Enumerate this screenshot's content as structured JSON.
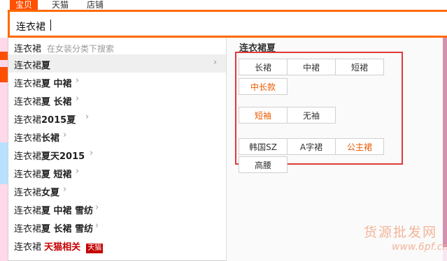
{
  "tabs": [
    "宝贝",
    "天猫",
    "店铺"
  ],
  "search": {
    "value": "连衣裙"
  },
  "suggestions": [
    {
      "prefix": "连衣裙",
      "bold": "",
      "hint": "在女装分类下搜索",
      "arrow": false
    },
    {
      "prefix": "连衣裙",
      "bold": "夏",
      "hint": "",
      "arrow": true
    },
    {
      "prefix": "连衣裙",
      "bold": "夏 中裙",
      "hint": "",
      "arrow": true
    },
    {
      "prefix": "连衣裙",
      "bold": "夏 长裙",
      "hint": "",
      "arrow": true
    },
    {
      "prefix": "连衣裙",
      "bold": "2015夏",
      "hint": "",
      "arrow": true
    },
    {
      "prefix": "连衣裙",
      "bold": "长裙",
      "hint": "",
      "arrow": true
    },
    {
      "prefix": "连衣裙",
      "bold": "夏天2015",
      "hint": "",
      "arrow": true
    },
    {
      "prefix": "连衣裙",
      "bold": "夏 短裙",
      "hint": "",
      "arrow": true
    },
    {
      "prefix": "连衣裙",
      "bold": "女夏",
      "hint": "",
      "arrow": true
    },
    {
      "prefix": "连衣裙",
      "bold": "夏 中裙 雪纺",
      "hint": "",
      "arrow": true
    },
    {
      "prefix": "连衣裙",
      "bold": "夏 长裙 雪纺",
      "hint": "",
      "arrow": true
    }
  ],
  "tmall_row": {
    "prefix": "连衣裙",
    "label": "天猫相关",
    "badge": "天猫"
  },
  "panel": {
    "title": "连衣裙夏",
    "group1": [
      "长裙",
      "中裙",
      "短裙",
      "中长款"
    ],
    "group2": [
      "短袖",
      "无袖"
    ],
    "group3": [
      "韩国SZ",
      "A字裙",
      "公主裙",
      "高腰"
    ]
  },
  "watermark": {
    "line1": "货源批发网",
    "line2": "www.6pf.cn"
  },
  "colors": {
    "accent": "#ff6a00",
    "highlight_box": "#e03a3a",
    "hot_text": "#e85a00",
    "tmall": "#c40000"
  }
}
